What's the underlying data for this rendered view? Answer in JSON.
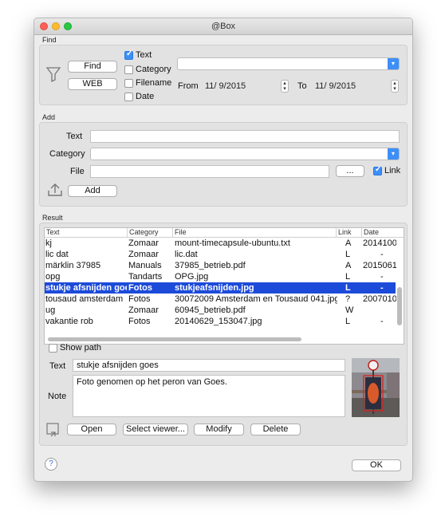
{
  "window": {
    "title": "@Box"
  },
  "find": {
    "section_label": "Find",
    "find_button": "Find",
    "web_button": "WEB",
    "checkboxes": [
      {
        "label": "Text",
        "checked": true
      },
      {
        "label": "Category",
        "checked": false
      },
      {
        "label": "Filename",
        "checked": false
      },
      {
        "label": "Date",
        "checked": false
      }
    ],
    "search_value": "",
    "from_label": "From",
    "from_date": "11/ 9/2015",
    "to_label": "To",
    "to_date": "11/ 9/2015"
  },
  "add": {
    "section_label": "Add",
    "text_label": "Text",
    "text_value": "",
    "category_label": "Category",
    "category_value": "",
    "file_label": "File",
    "file_value": "",
    "browse_button": "...",
    "link_label": "Link",
    "link_checked": true,
    "add_button": "Add"
  },
  "result": {
    "section_label": "Result",
    "columns": [
      "Text",
      "Category",
      "File",
      "Link",
      "Date"
    ],
    "rows": [
      {
        "text": "kj",
        "category": "Zomaar",
        "file": "mount-timecapsule-ubuntu.txt",
        "link": "A",
        "date": "2014100"
      },
      {
        "text": "lic dat",
        "category": "Zomaar",
        "file": "lic.dat",
        "link": "L",
        "date": "-"
      },
      {
        "text": "märklin 37985",
        "category": "Manuals",
        "file": "37985_betrieb.pdf",
        "link": "A",
        "date": "2015061"
      },
      {
        "text": "opg",
        "category": "Tandarts",
        "file": "OPG.jpg",
        "link": "L",
        "date": "-"
      },
      {
        "text": "stukje afsnijden goes",
        "category": "Fotos",
        "file": "stukjeafsnijden.jpg",
        "link": "L",
        "date": "-",
        "selected": true
      },
      {
        "text": "tousaud amsterdam",
        "category": "Fotos",
        "file": "30072009 Amsterdam en Tousaud 041.jpg",
        "link": "?",
        "date": "2007010"
      },
      {
        "text": "ug",
        "category": "Zomaar",
        "file": "60945_betrieb.pdf",
        "link": "W",
        "date": ""
      },
      {
        "text": "vakantie rob",
        "category": "Fotos",
        "file": "20140629_153047.jpg",
        "link": "L",
        "date": "-"
      }
    ],
    "show_path_label": "Show path",
    "show_path_checked": false,
    "text_label": "Text",
    "text_value": "stukje afsnijden goes",
    "note_label": "Note",
    "note_value": "Foto genomen op het peron van Goes.",
    "buttons": {
      "open": "Open",
      "select_viewer": "Select viewer...",
      "modify": "Modify",
      "delete": "Delete"
    }
  },
  "footer": {
    "help": "?",
    "ok": "OK"
  },
  "icons": [
    "filter-icon",
    "upload-icon",
    "export-icon",
    "help-icon"
  ]
}
